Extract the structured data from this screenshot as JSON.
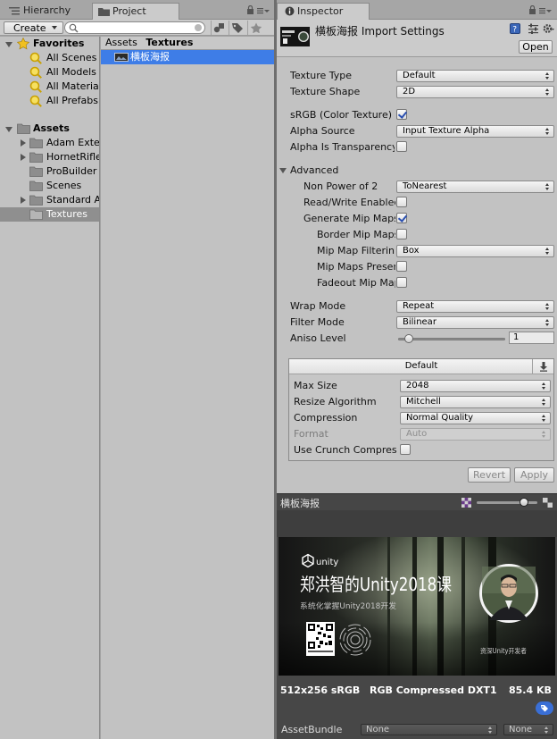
{
  "tabs": {
    "hierarchy": "Hierarchy",
    "project": "Project",
    "inspector": "Inspector"
  },
  "project": {
    "create_label": "Create",
    "search_placeholder": "",
    "favorites": {
      "label": "Favorites",
      "items": [
        "All Scenes",
        "All Models",
        "All Materials",
        "All Prefabs"
      ]
    },
    "assets": {
      "label": "Assets",
      "items": [
        "Adam Exterior",
        "HornetRifle",
        "ProBuilder",
        "Scenes",
        "Standard Assets",
        "Textures"
      ],
      "selected": "Textures"
    },
    "breadcrumb": [
      "Assets",
      "Textures"
    ],
    "selected_asset": "横板海报"
  },
  "inspector": {
    "asset_name": "横板海报",
    "title_suffix": "Import Settings",
    "open_label": "Open",
    "fields": {
      "texture_type": {
        "label": "Texture Type",
        "value": "Default"
      },
      "texture_shape": {
        "label": "Texture Shape",
        "value": "2D"
      },
      "srgb": {
        "label": "sRGB (Color Texture)",
        "checked": true
      },
      "alpha_source": {
        "label": "Alpha Source",
        "value": "Input Texture Alpha"
      },
      "alpha_transparency": {
        "label": "Alpha Is Transparency",
        "checked": false
      }
    },
    "advanced": {
      "label": "Advanced",
      "non_power_of_2": {
        "label": "Non Power of 2",
        "value": "ToNearest"
      },
      "read_write": {
        "label": "Read/Write Enabled",
        "checked": false
      },
      "generate_mip": {
        "label": "Generate Mip Maps",
        "checked": true
      },
      "border_mip": {
        "label": "Border Mip Maps",
        "checked": false
      },
      "mip_filtering": {
        "label": "Mip Map Filtering",
        "value": "Box"
      },
      "mip_preserve": {
        "label": "Mip Maps Preserve Coverage",
        "checked": false
      },
      "fadeout_mip": {
        "label": "Fadeout Mip Maps",
        "checked": false
      }
    },
    "wrap_mode": {
      "label": "Wrap Mode",
      "value": "Repeat"
    },
    "filter_mode": {
      "label": "Filter Mode",
      "value": "Bilinear"
    },
    "aniso_level": {
      "label": "Aniso Level",
      "value": "1",
      "slider_fraction": 0.06
    },
    "platform": {
      "tab": "Default",
      "max_size": {
        "label": "Max Size",
        "value": "2048"
      },
      "resize_algorithm": {
        "label": "Resize Algorithm",
        "value": "Mitchell"
      },
      "compression": {
        "label": "Compression",
        "value": "Normal Quality"
      },
      "format": {
        "label": "Format",
        "value": "Auto"
      },
      "crunch": {
        "label": "Use Crunch Compression",
        "checked": false
      }
    },
    "revert_label": "Revert",
    "apply_label": "Apply"
  },
  "preview": {
    "title": "横板海报",
    "mip_fraction": 0.82,
    "banner": {
      "logo": "unity",
      "headline": "郑洪智的Unity2018课",
      "subline": "系统化掌握Unity2018开发",
      "caption": "资深Unity开发者"
    },
    "info": {
      "dimensions": "512x256 sRGB",
      "format": "RGB Compressed DXT1",
      "size": "85.4 KB"
    },
    "assetbundle": {
      "label": "AssetBundle",
      "name": "None",
      "variant": "None"
    }
  },
  "colors": {
    "selection": "#3e7de7",
    "panel": "#c2c2c2",
    "preview_bg": "#474747"
  }
}
